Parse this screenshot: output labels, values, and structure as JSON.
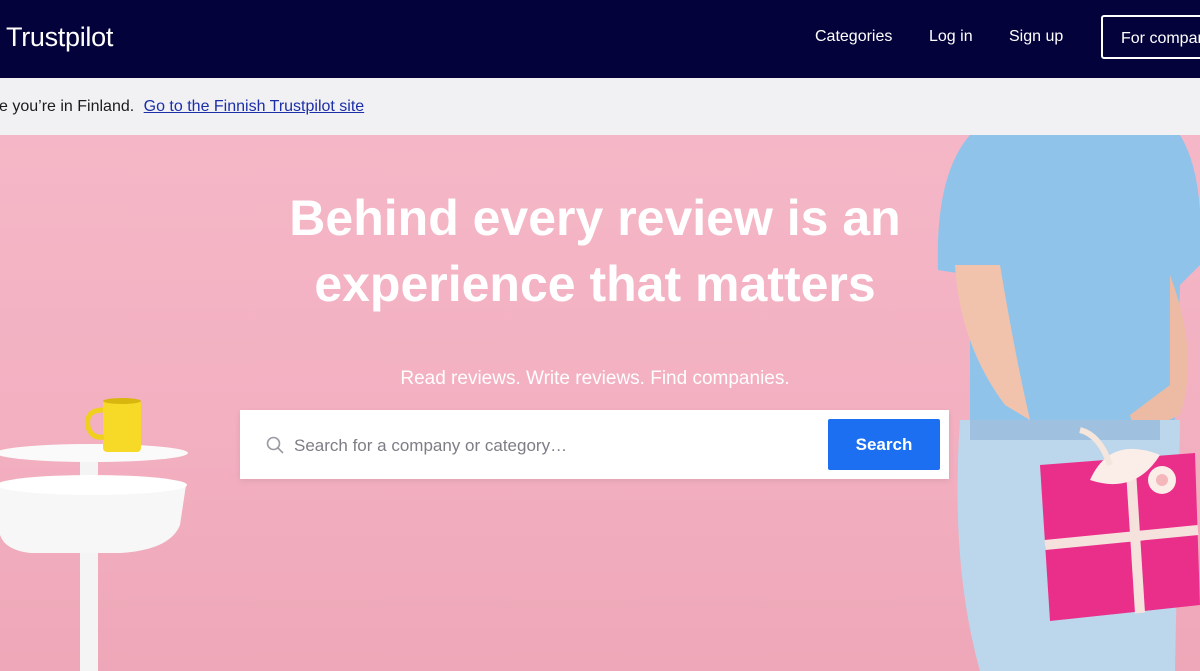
{
  "nav": {
    "brand": "Trustpilot",
    "links": [
      "Categories",
      "Log in",
      "Sign up"
    ],
    "business_button": "For companies"
  },
  "banner": {
    "text": "ke you’re in Finland.",
    "link": "Go to the Finnish Trustpilot site"
  },
  "hero": {
    "headline_line1": "Behind every review is an",
    "headline_line2": "experience that matters",
    "subline": "Read reviews. Write reviews. Find companies.",
    "search_placeholder": "Search for a company or category…",
    "search_button": "Search"
  },
  "colors": {
    "nav_bg": "#04023a",
    "hero_bg": "#f3b4c5",
    "accent": "#1c6ff0"
  }
}
